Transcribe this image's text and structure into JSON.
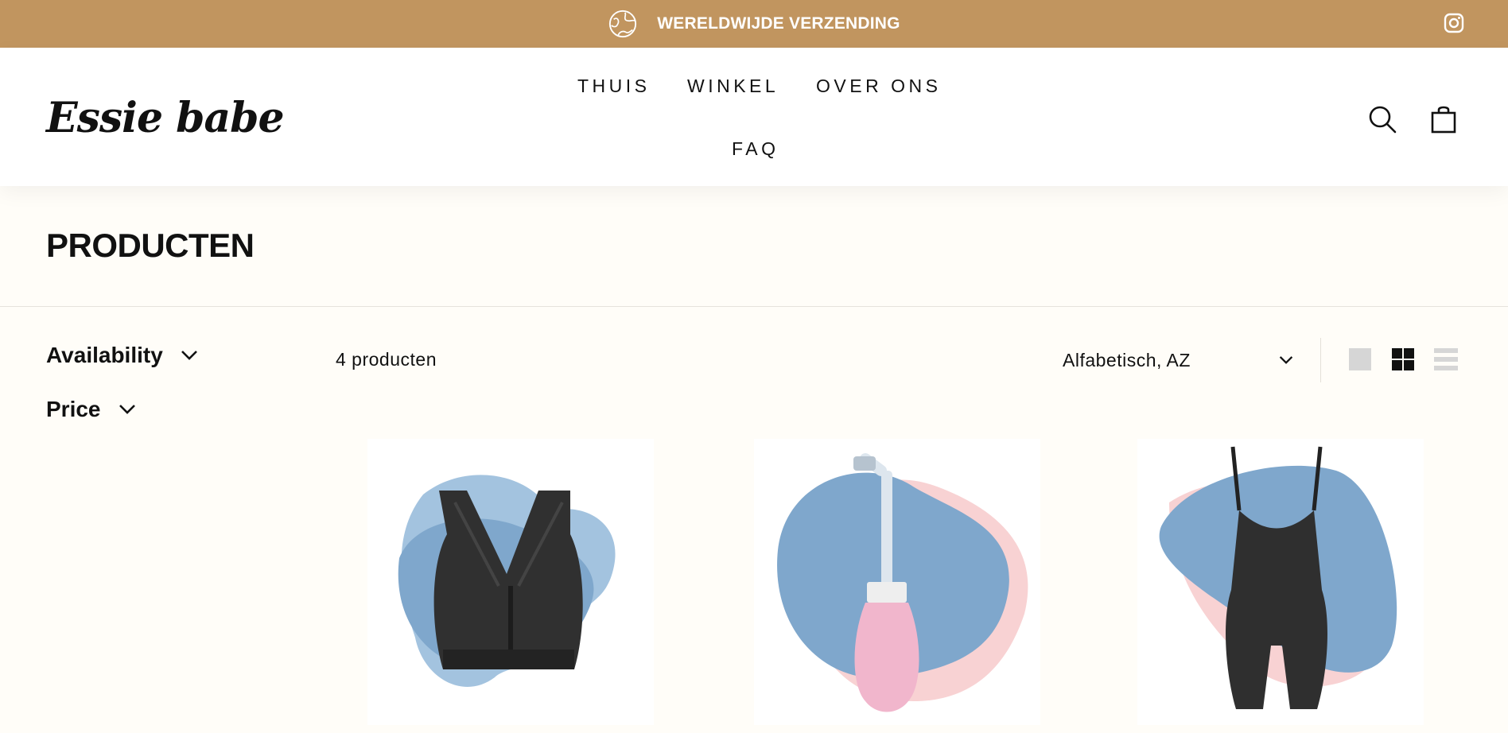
{
  "announcement": {
    "text": "WERELDWIJDE VERZENDING",
    "icon": "globe-icon",
    "social_icon": "instagram-icon"
  },
  "header": {
    "logo": "Essie babe",
    "nav": [
      "THUIS",
      "WINKEL",
      "OVER ONS",
      "FAQ"
    ],
    "icons": [
      "search-icon",
      "bag-icon"
    ]
  },
  "collection": {
    "title": "PRODUCTEN",
    "count": "4 producten",
    "filters": [
      "Availability",
      "Price"
    ],
    "sort_value": "Alfabetisch, AZ",
    "view_modes": [
      "large-view-icon",
      "grid-view-icon",
      "list-view-icon"
    ],
    "active_view": "grid-view-icon"
  },
  "products": [
    {
      "image": "black-nursing-bra"
    },
    {
      "image": "pink-peri-bottle"
    },
    {
      "image": "black-bodysuit"
    }
  ],
  "colors": {
    "announcement_bg": "#c1955f",
    "page_bg": "#fffdf8",
    "blob_blue": "#7fa7cc",
    "blob_pink": "#f8d2d3"
  }
}
